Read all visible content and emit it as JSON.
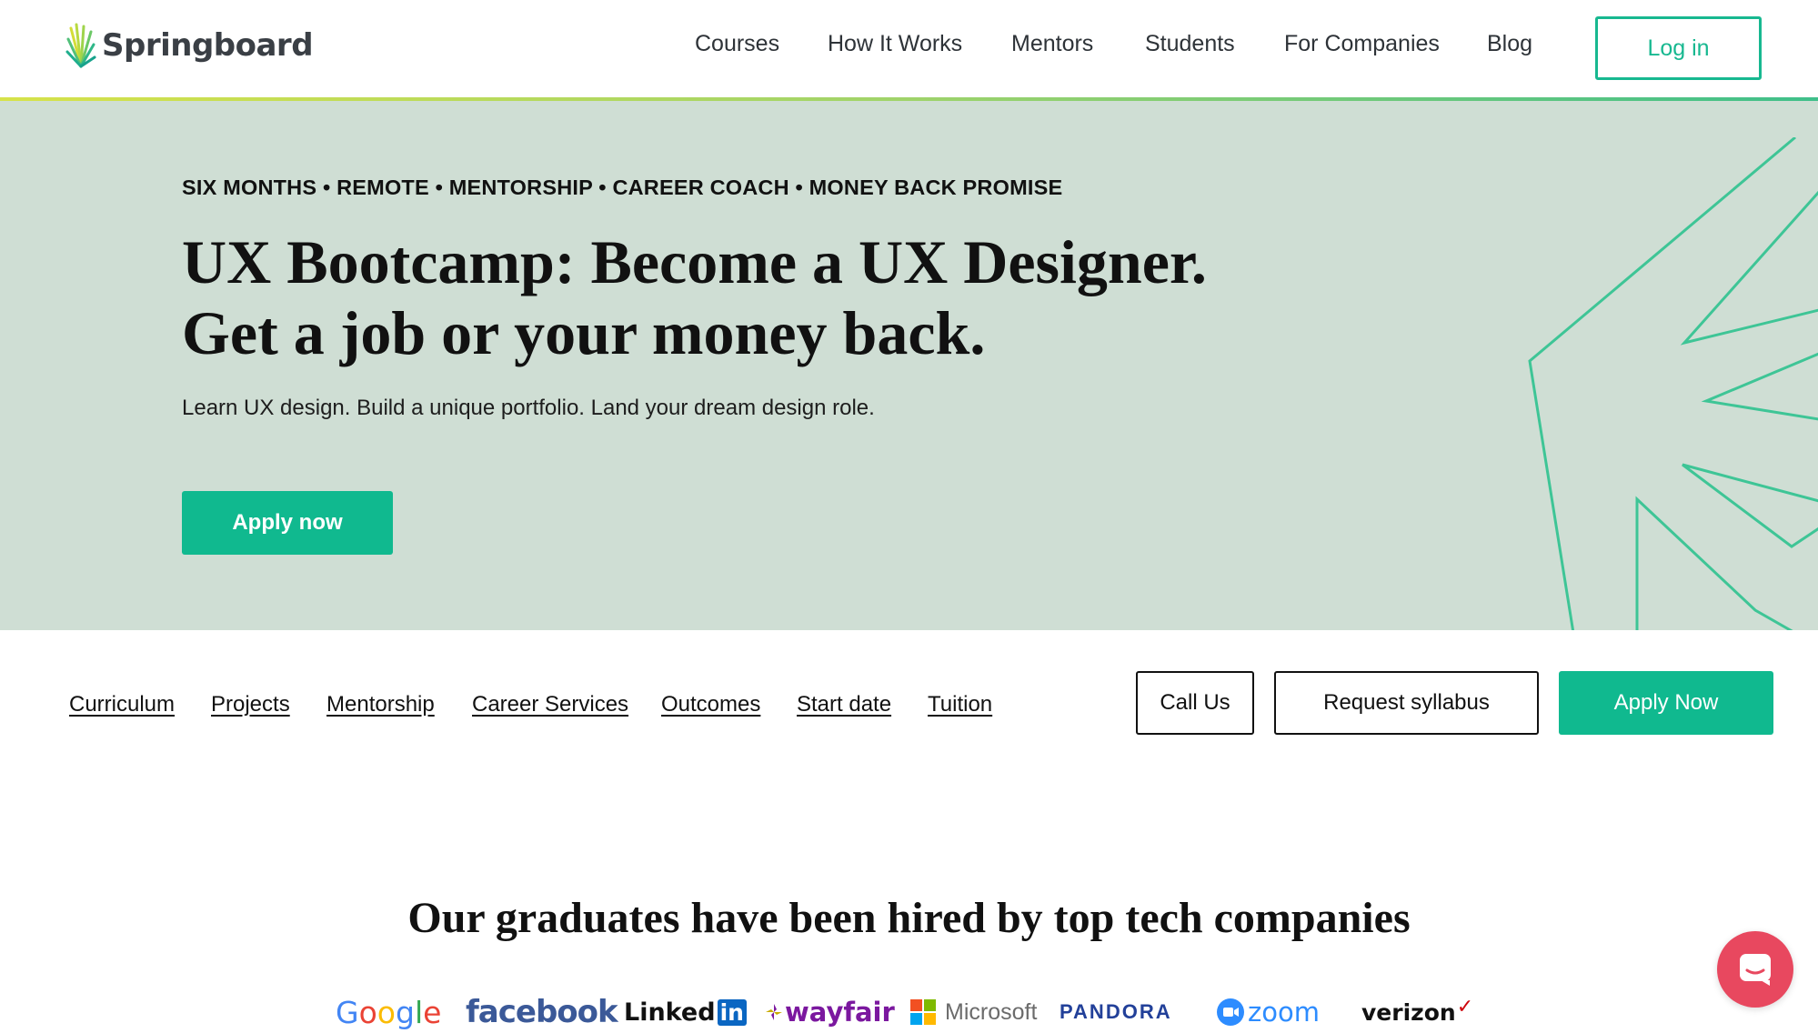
{
  "brand": {
    "name": "Springboard"
  },
  "topnav": {
    "items": [
      "Courses",
      "How It Works",
      "Mentors",
      "Students",
      "For Companies",
      "Blog"
    ],
    "login_label": "Log in"
  },
  "hero": {
    "eyebrow": "SIX MONTHS • REMOTE • MENTORSHIP • CAREER COACH • MONEY BACK PROMISE",
    "title_line1": "UX Bootcamp: Become a UX Designer.",
    "title_line2": "Get a job or your money back.",
    "subtitle": "Learn UX design. Build a unique portfolio. Land your dream design role.",
    "cta_label": "Apply now",
    "background_color": "#cfded4"
  },
  "subnav": {
    "links": [
      "Curriculum",
      "Projects",
      "Mentorship",
      "Career Services",
      "Outcomes",
      "Start date",
      "Tuition"
    ],
    "call_label": "Call Us",
    "syllabus_label": "Request syllabus",
    "apply_label": "Apply Now"
  },
  "companies": {
    "title": "Our graduates have been hired by top tech companies",
    "logos": {
      "google": "Google",
      "facebook": "facebook",
      "linkedin_text": "Linked",
      "linkedin_in": "in",
      "wayfair": "wayfair",
      "microsoft": "Microsoft",
      "pandora": "PANDORA",
      "zoom": "zoom",
      "verizon": "verizon",
      "verizon_check": "✓"
    }
  },
  "colors": {
    "accent": "#10b98f",
    "hero_bg": "#cfded4",
    "chat": "#e8485f"
  },
  "icons": {
    "chat": "chat-bubble-icon",
    "logo": "springboard-leaf-icon"
  }
}
